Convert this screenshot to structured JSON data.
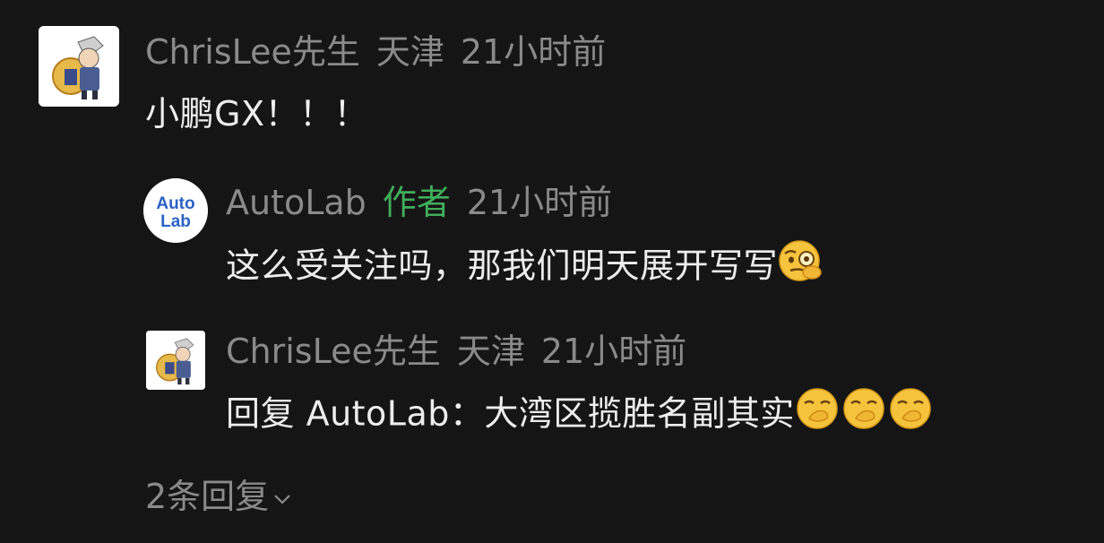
{
  "comment": {
    "username": "ChrisLee先生",
    "location": "天津",
    "time": "21小时前",
    "text": "小鹏GX！！！",
    "avatar_icon": "avatar-knight-shield"
  },
  "replies": [
    {
      "username": "AutoLab",
      "badge": "作者",
      "time": "21小时前",
      "text": "这么受关注吗，那我们明天展开写写",
      "emoji": [
        "thinking-monocle-emoji"
      ],
      "avatar_logo_line1": "Auto",
      "avatar_logo_line2": "Lab"
    },
    {
      "username": "ChrisLee先生",
      "location": "天津",
      "time": "21小时前",
      "text": "回复 AutoLab：大湾区揽胜名副其实",
      "emoji": [
        "hand-over-mouth-emoji",
        "hand-over-mouth-emoji",
        "hand-over-mouth-emoji"
      ],
      "avatar_icon": "avatar-knight-shield"
    }
  ],
  "more_replies": "2条回复",
  "more_icon": "chevron-down-icon",
  "colors": {
    "background": "#151515",
    "meta_text": "#8a8a8a",
    "body_text": "#ededed",
    "author_badge": "#3fae5a",
    "logo_blue": "#2b62c6"
  }
}
